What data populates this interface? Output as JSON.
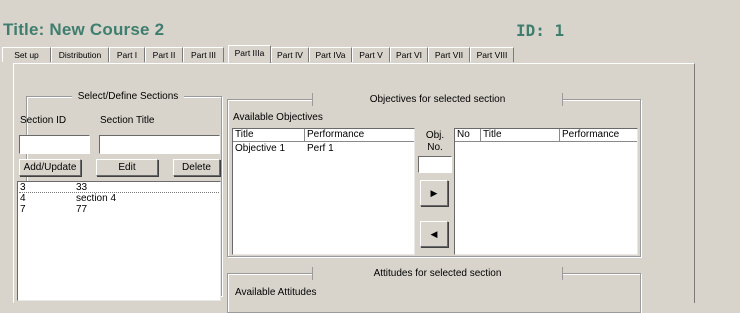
{
  "header": {
    "title": "Title:  New Course 2",
    "id_text": "ID:  1"
  },
  "tabs": [
    {
      "label": "Set up"
    },
    {
      "label": "Distribution"
    },
    {
      "label": "Part I"
    },
    {
      "label": "Part II"
    },
    {
      "label": "Part III"
    },
    {
      "label": "Part IIIa"
    },
    {
      "label": "Part IV"
    },
    {
      "label": "Part IVa"
    },
    {
      "label": "Part V"
    },
    {
      "label": "Part VI"
    },
    {
      "label": "Part VII"
    },
    {
      "label": "Part VIII"
    }
  ],
  "active_tab": "Part IIIa",
  "sections": {
    "group_title": "Select/Define Sections",
    "id_label": "Section ID",
    "title_label": "Section Title",
    "id_value": "",
    "title_value": "",
    "add_label": "Add/Update",
    "edit_label": "Edit",
    "delete_label": "Delete",
    "rows": [
      {
        "id": "3",
        "title": "33"
      },
      {
        "id": "4",
        "title": "section 4"
      },
      {
        "id": "7",
        "title": "77"
      }
    ]
  },
  "objectives": {
    "group_title": "Objectives for selected section",
    "available_label": "Available Objectives",
    "available_columns": [
      "Title",
      "Performance"
    ],
    "available_rows": [
      {
        "title": "Objective 1",
        "performance": "Perf 1"
      }
    ],
    "obj_no_label_1": "Obj.",
    "obj_no_label_2": "No.",
    "obj_no_value": "",
    "add_arrow": "▶",
    "remove_arrow": "◀",
    "selected_columns": [
      "No",
      "Title",
      "Performance"
    ],
    "selected_rows": []
  },
  "attitudes": {
    "group_title": "Attitudes for selected section",
    "available_label": "Available Attitudes"
  },
  "colors": {
    "title_green": "#3f7e6e",
    "background": "#d8d4cc"
  }
}
